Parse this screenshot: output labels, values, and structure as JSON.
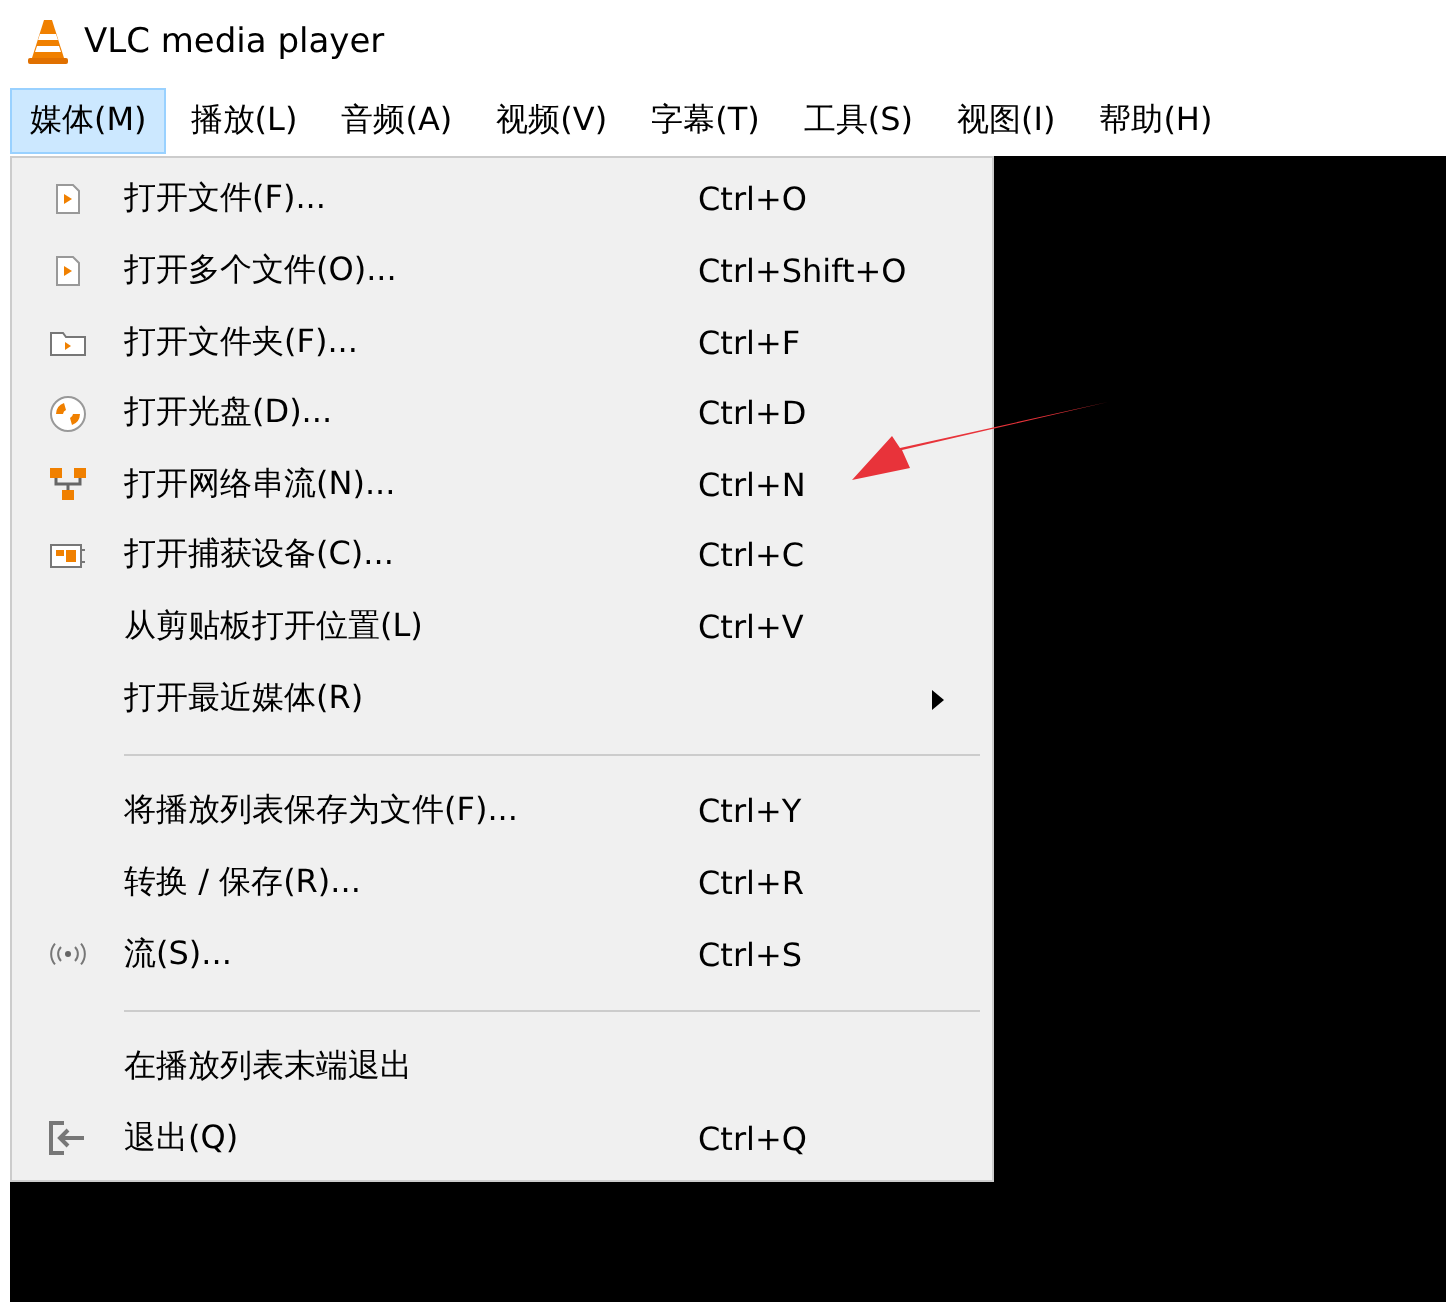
{
  "window": {
    "title": "VLC media player"
  },
  "menubar": [
    {
      "label": "媒体(M)",
      "selected": true
    },
    {
      "label": "播放(L)",
      "selected": false
    },
    {
      "label": "音频(A)",
      "selected": false
    },
    {
      "label": "视频(V)",
      "selected": false
    },
    {
      "label": "字幕(T)",
      "selected": false
    },
    {
      "label": "工具(S)",
      "selected": false
    },
    {
      "label": "视图(I)",
      "selected": false
    },
    {
      "label": "帮助(H)",
      "selected": false
    }
  ],
  "menu": [
    {
      "kind": "item",
      "label": "打开文件(F)...",
      "shortcut": "Ctrl+O"
    },
    {
      "kind": "item",
      "label": "打开多个文件(O)...",
      "shortcut": "Ctrl+Shift+O"
    },
    {
      "kind": "item",
      "label": "打开文件夹(F)...",
      "shortcut": "Ctrl+F"
    },
    {
      "kind": "item",
      "label": "打开光盘(D)...",
      "shortcut": "Ctrl+D"
    },
    {
      "kind": "item",
      "label": "打开网络串流(N)...",
      "shortcut": "Ctrl+N"
    },
    {
      "kind": "item",
      "label": "打开捕获设备(C)...",
      "shortcut": "Ctrl+C"
    },
    {
      "kind": "item",
      "label": "从剪贴板打开位置(L)",
      "shortcut": "Ctrl+V"
    },
    {
      "kind": "submenu",
      "label": "打开最近媒体(R)"
    },
    {
      "kind": "separator"
    },
    {
      "kind": "item",
      "label": "将播放列表保存为文件(F)...",
      "shortcut": "Ctrl+Y"
    },
    {
      "kind": "item",
      "label": "转换 / 保存(R)...",
      "shortcut": "Ctrl+R"
    },
    {
      "kind": "item",
      "label": "流(S)...",
      "shortcut": "Ctrl+S"
    },
    {
      "kind": "separator"
    },
    {
      "kind": "item",
      "label": "在播放列表末端退出"
    },
    {
      "kind": "item",
      "label": "退出(Q)",
      "shortcut": "Ctrl+Q"
    }
  ],
  "annotation": {
    "kind": "arrow"
  }
}
